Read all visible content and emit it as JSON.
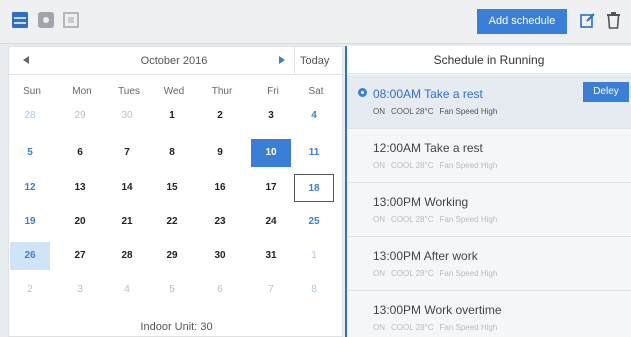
{
  "toolbar": {
    "icons": [
      "list-icon",
      "gear-icon",
      "grid-icon"
    ],
    "add_label": "Add schedule",
    "edit_icon": "edit-icon",
    "trash_icon": "trash-icon"
  },
  "calendar": {
    "title": "October 2016",
    "today_label": "Today",
    "weekdays": [
      "Sun",
      "Mon",
      "Tues",
      "Wed",
      "Thur",
      "Fri",
      "Sat"
    ],
    "weeks": [
      [
        "28",
        "29",
        "30",
        "1",
        "2",
        "3",
        "4"
      ],
      [
        "5",
        "6",
        "7",
        "8",
        "9",
        "10",
        "11"
      ],
      [
        "12",
        "13",
        "14",
        "15",
        "16",
        "17",
        "18"
      ],
      [
        "19",
        "20",
        "21",
        "22",
        "23",
        "24",
        "25"
      ],
      [
        "26",
        "27",
        "28",
        "29",
        "30",
        "31",
        "1"
      ],
      [
        "2",
        "3",
        "4",
        "5",
        "6",
        "7",
        "8"
      ]
    ],
    "selected": "10",
    "today": "18",
    "highlighted": "26",
    "footer": "Indoor Unit: 30"
  },
  "schedule": {
    "title": "Schedule in Running",
    "delete_label": "Deley",
    "items": [
      {
        "time": "08:00AM",
        "name": "Take a rest",
        "mode": "ON",
        "temp": "COOL 28°C",
        "fan": "Fan Speed High",
        "active": true
      },
      {
        "time": "12:00AM",
        "name": "Take a rest",
        "mode": "ON",
        "temp": "COOL 28°C",
        "fan": "Fan Speed High",
        "active": false
      },
      {
        "time": "13:00PM",
        "name": "Working",
        "mode": "ON",
        "temp": "COOL 28°C",
        "fan": "Fan Speed High",
        "active": false
      },
      {
        "time": "13:00PM",
        "name": "After work",
        "mode": "ON",
        "temp": "COOL 28°C",
        "fan": "Fan Speed High",
        "active": false
      },
      {
        "time": "13:00PM",
        "name": "Work overtime",
        "mode": "ON",
        "temp": "COOL 28°C",
        "fan": "Fan Speed High",
        "active": false
      }
    ]
  },
  "colors": {
    "accent": "#3a7fd5",
    "selected_bg": "#3a7fd5",
    "highlight_bg": "#cfe5f7"
  }
}
